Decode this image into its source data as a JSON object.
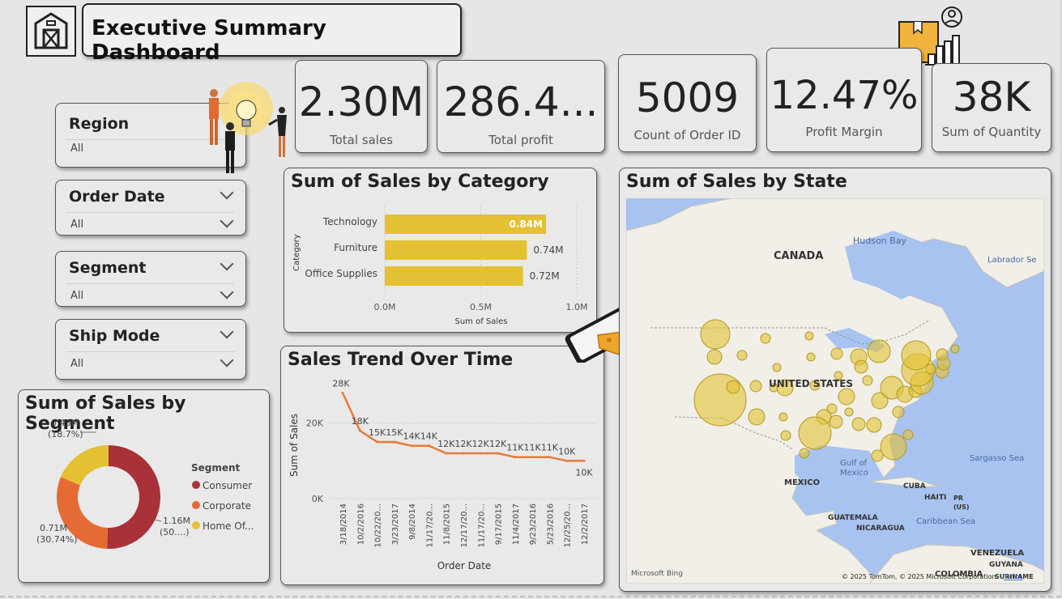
{
  "header": {
    "title": "Executive Summary Dashboard",
    "logo_icon": "warehouse-icon",
    "decor_icon": "box-chart-person-icon"
  },
  "kpis": [
    {
      "value": "2.30M",
      "label": "Total sales"
    },
    {
      "value": "286.4...",
      "label": "Total profit"
    },
    {
      "value": "5009",
      "label": "Count of Order ID"
    },
    {
      "value": "12.47%",
      "label": "Profit Margin"
    },
    {
      "value": "38K",
      "label": "Sum of Quantity"
    }
  ],
  "slicers": [
    {
      "title": "Region",
      "value": "All"
    },
    {
      "title": "Order Date",
      "value": "All"
    },
    {
      "title": "Segment",
      "value": "All"
    },
    {
      "title": "Ship Mode",
      "value": "All"
    }
  ],
  "colors": {
    "accent": "#e3c132",
    "line": "#e87a3b",
    "consumer": "#a8313a",
    "corporate": "#e56b35",
    "home_office": "#e3c132",
    "map_water": "#a8c3f0"
  },
  "category_chart": {
    "title": "Sum of Sales by Category",
    "chart_data": {
      "type": "bar",
      "categories": [
        "Technology",
        "Furniture",
        "Office Supplies"
      ],
      "values": [
        0.84,
        0.74,
        0.72
      ],
      "data_labels": [
        "0.84M",
        "0.74M",
        "0.72M"
      ],
      "xlabel": "Sum of Sales",
      "ylabel": "Category",
      "xticks": [
        "0.0M",
        "0.5M",
        "1.0M"
      ],
      "xlim": [
        0,
        1.0
      ]
    }
  },
  "trend_chart": {
    "title": "Sales Trend Over Time",
    "chart_data": {
      "type": "line",
      "x": [
        "3/18/2014",
        "10/2/2016",
        "10/22/20...",
        "3/23/2017",
        "9/8/2014",
        "11/17/20...",
        "11/8/2015",
        "12/17/20...",
        "11/17/20...",
        "9/17/2015",
        "11/4/2017",
        "9/23/2016",
        "5/23/2016",
        "12/25/20...",
        "12/2/2017"
      ],
      "values": [
        28,
        18,
        15,
        15,
        14,
        14,
        12,
        12,
        12,
        12,
        11,
        11,
        11,
        10,
        10
      ],
      "data_labels": [
        "28K",
        "18K",
        "15K",
        "15K",
        "14K",
        "14K",
        "12K",
        "12K",
        "12K",
        "12K",
        "11K",
        "11K",
        "11K",
        "10K",
        "10K"
      ],
      "xlabel": "Order Date",
      "ylabel": "Sum of Sales",
      "yticks": [
        "0K",
        "20K"
      ],
      "ylim": [
        0,
        30
      ]
    }
  },
  "segment_chart": {
    "title": "Sum of Sales by Segment",
    "legend_title": "Segment",
    "chart_data": {
      "type": "pie",
      "categories": [
        "Consumer",
        "Corporate",
        "Home Of..."
      ],
      "values": [
        1.16,
        0.71,
        0.43
      ],
      "percents": [
        50.56,
        30.74,
        18.7
      ],
      "data_labels": [
        "1.16M",
        "0.71M",
        "0.43M"
      ],
      "percent_labels": [
        "(50....)",
        "(30.74%)",
        "(18.7%)"
      ]
    }
  },
  "map": {
    "title": "Sum of Sales by State",
    "labels": [
      "CANADA",
      "Hudson Bay",
      "Labrador Se",
      "UNITED STATES",
      "Gulf of",
      "Mexico",
      "MEXICO",
      "Sargasso Sea",
      "CUBA",
      "HAITI",
      "PR",
      "(US)",
      "GUATEMALA",
      "NICARAGUA",
      "Caribbean Sea",
      "VENEZUELA",
      "GUYANA",
      "COLOMBIA",
      "SURINAME"
    ],
    "attribution": "© 2025 TomTom, © 2025 Microsoft Corporation",
    "terms": "Terms",
    "bing": "Microsoft Bing"
  }
}
